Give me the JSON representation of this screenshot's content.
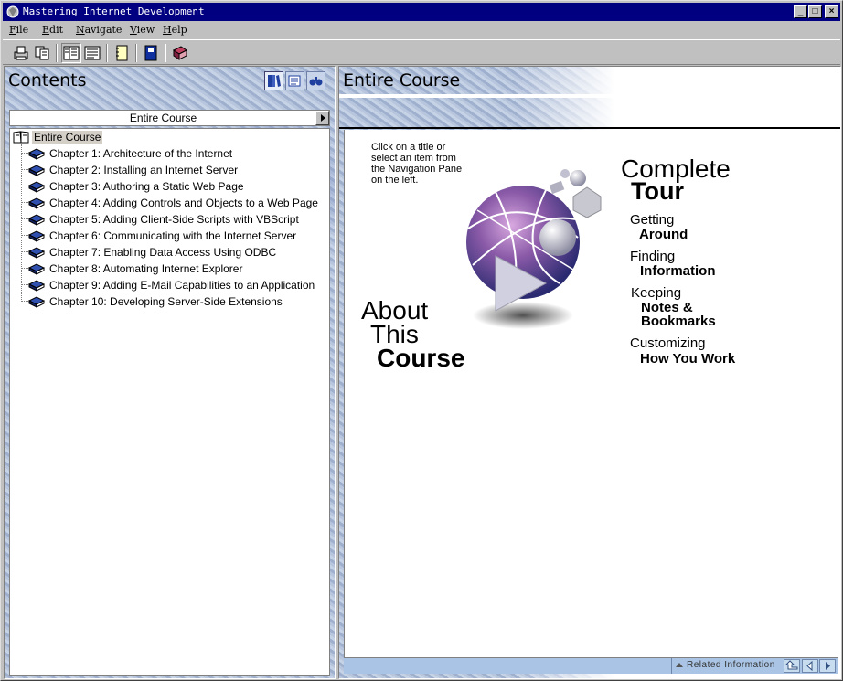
{
  "window": {
    "title": "Mastering Internet Development",
    "controls": [
      "_",
      "□",
      "×"
    ]
  },
  "menu": [
    {
      "key": "F",
      "rest": "ile"
    },
    {
      "key": "E",
      "rest": "dit"
    },
    {
      "key": "N",
      "rest": "avigate"
    },
    {
      "key": "V",
      "rest": "iew"
    },
    {
      "key": "H",
      "rest": "elp"
    }
  ],
  "toolbar": {
    "icons": [
      "print-icon",
      "copy-icon",
      "navigation-pane-icon",
      "text-pane-icon",
      "notes-icon",
      "bookmark-icon",
      "book-icon"
    ]
  },
  "left_pane": {
    "header": "Contents",
    "header_icons": [
      "contents-tab-icon",
      "index-tab-icon",
      "search-tab-icon"
    ],
    "dropdown_value": "Entire Course",
    "tree": {
      "root": "Entire Course",
      "items": [
        "Chapter 1: Architecture of the Internet",
        "Chapter 2: Installing an Internet Server",
        "Chapter 3: Authoring a Static Web Page",
        "Chapter 4: Adding Controls and Objects to a Web Page",
        "Chapter 5: Adding Client-Side Scripts with VBScript",
        "Chapter 6: Communicating with the Internet Server",
        "Chapter 7: Enabling Data Access Using ODBC",
        "Chapter 8: Automating Internet Explorer",
        "Chapter 9: Adding E-Mail Capabilities to an Application",
        "Chapter 10: Developing Server-Side Extensions"
      ]
    }
  },
  "right_pane": {
    "header": "Entire Course",
    "hint": "Click on a title or select an item from the Navigation Pane on the left.",
    "about": {
      "line1": "About",
      "line2": "This",
      "line3": "Course"
    },
    "tour": {
      "line1": "Complete",
      "line2": "Tour"
    },
    "links": [
      {
        "light": "Getting",
        "bold": "Around"
      },
      {
        "light": "Finding",
        "bold": "Information"
      },
      {
        "light": "Keeping",
        "bold": "Notes &",
        "bold2": "Bookmarks"
      },
      {
        "light": "Customizing",
        "bold": "How You Work"
      }
    ],
    "status": {
      "related": "Related Information",
      "nav_icons": [
        "up-icon",
        "back-icon",
        "forward-icon"
      ]
    }
  }
}
